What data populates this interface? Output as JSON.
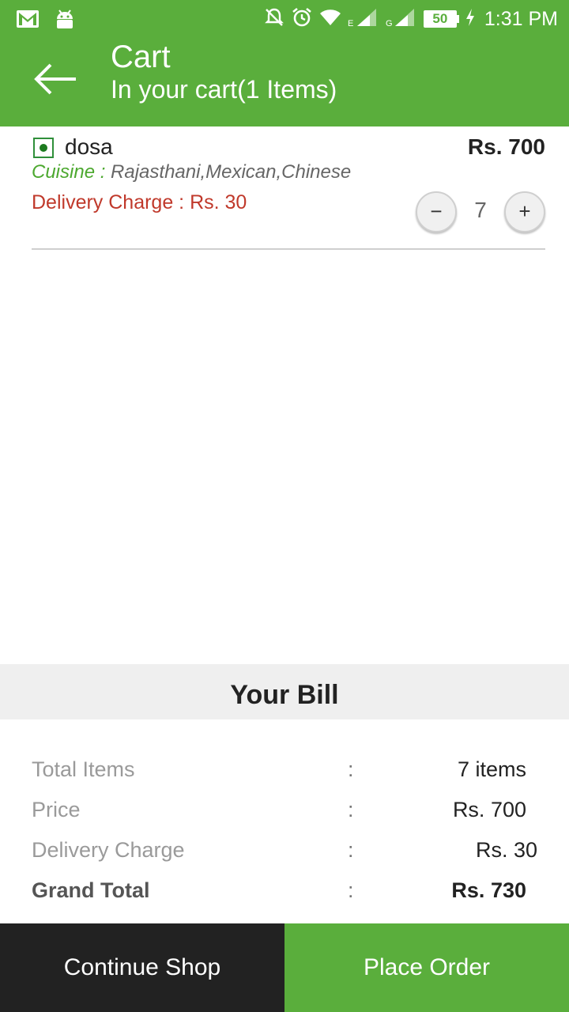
{
  "status_bar": {
    "time": "1:31 PM",
    "battery": "50",
    "icons": [
      "gmail-icon",
      "android-icon",
      "notifications-off-icon",
      "alarm-icon",
      "wifi-icon",
      "signal-e-icon",
      "signal-g-icon",
      "battery-icon",
      "charging-icon"
    ]
  },
  "header": {
    "title": "Cart",
    "subtitle": "In your cart(1 Items)",
    "back_icon": "back-arrow-icon"
  },
  "cart_items": [
    {
      "name": "dosa",
      "price": "Rs. 700",
      "cuisine_label": "Cuisine :",
      "cuisine": "Rajasthani,Mexican,Chinese",
      "delivery": "Delivery Charge : Rs. 30",
      "quantity": "7",
      "minus": "−",
      "plus": "+"
    }
  ],
  "bill": {
    "title": "Your Bill",
    "rows": [
      {
        "label": "Total Items",
        "colon": ":",
        "value": "7 items"
      },
      {
        "label": "Price",
        "colon": ":",
        "value": "Rs. 700"
      },
      {
        "label": "Delivery Charge",
        "colon": ":",
        "value": "Rs. 30"
      },
      {
        "label": "Grand Total",
        "colon": ":",
        "value": "Rs. 730"
      }
    ]
  },
  "actions": {
    "continue_label": "Continue Shop",
    "place_label": "Place Order"
  },
  "colors": {
    "primary": "#5aae3c",
    "dark": "#222222",
    "delivery": "#c0392b"
  }
}
